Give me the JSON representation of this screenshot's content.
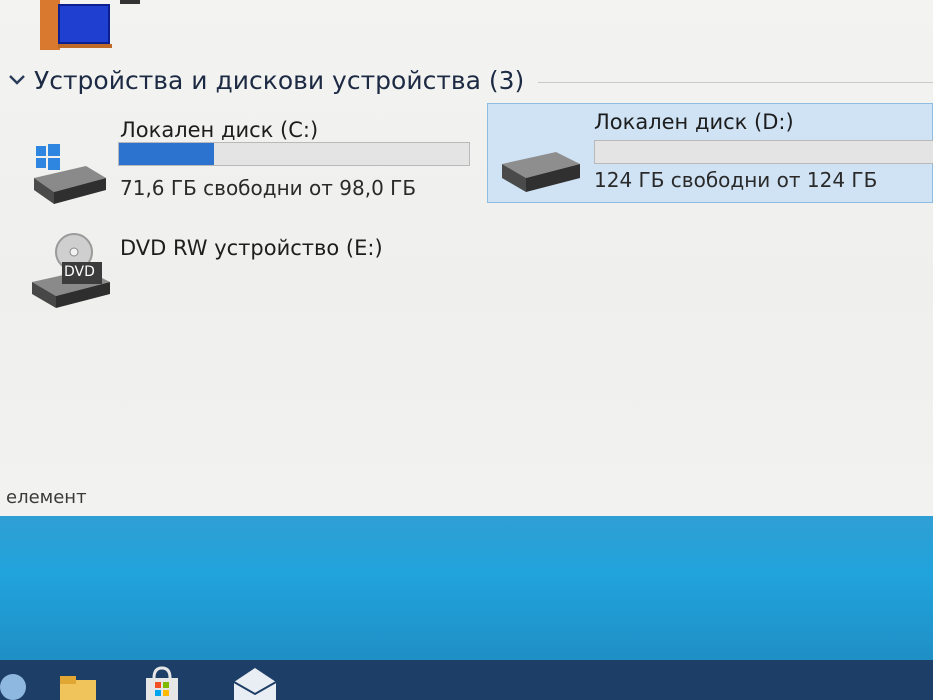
{
  "group": {
    "title": "Устройства и дискови устройства (3)"
  },
  "drives": {
    "c": {
      "name": "Локален диск (C:)",
      "free_text": "71,6 ГБ свободни от 98,0 ГБ",
      "used_fraction": 0.27,
      "icon": "windows-drive-icon"
    },
    "d": {
      "name": "Локален диск (D:)",
      "free_text": "124 ГБ свободни от 124 ГБ",
      "used_fraction": 0.0,
      "icon": "hard-drive-icon"
    },
    "e": {
      "name": "DVD RW устройство (E:)",
      "icon": "dvd-drive-icon",
      "badge": "DVD"
    }
  },
  "status": {
    "text": "елемент"
  },
  "colors": {
    "bar_fill": "#2c73cf",
    "selection": "#cfe3f5",
    "taskbar": "#1d3e67",
    "desktop": "#21a3dc"
  },
  "taskbar": {
    "icons": [
      "start-icon",
      "file-explorer-icon",
      "store-icon",
      "mail-icon"
    ]
  }
}
